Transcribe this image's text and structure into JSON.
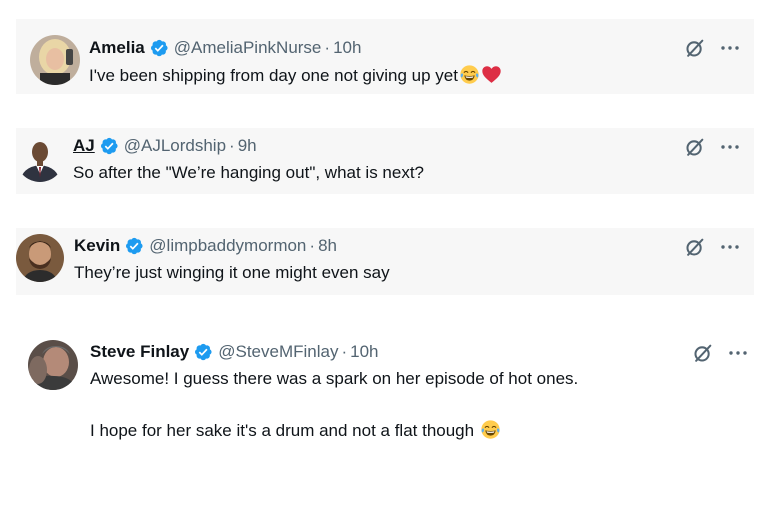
{
  "tweets": [
    {
      "name": "Amelia",
      "handle": "@AmeliaPinkNurse",
      "separator": "·",
      "time": "10h",
      "text": "I've been shipping from day one not giving up yet",
      "emojis": [
        "face-with-tears-of-joy",
        "red-heart"
      ]
    },
    {
      "name": "AJ",
      "handle": "@AJLordship",
      "separator": "·",
      "time": "9h",
      "text": "So after the \"We’re hanging out\", what is next?"
    },
    {
      "name": "Kevin",
      "handle": "@limpbaddymormon",
      "separator": "·",
      "time": "8h",
      "text": "They’re just winging it one might even say"
    },
    {
      "name": "Steve Finlay",
      "handle": "@SteveMFinlay",
      "separator": "·",
      "time": "10h",
      "text_line1": "Awesome! I guess there was a spark on her episode of hot ones.",
      "text_line2": "I hope for her sake it's a drum and not a flat though",
      "emojis": [
        "face-with-tears-of-joy"
      ]
    }
  ],
  "icons": {
    "verified": "verified-badge-icon",
    "grok": "grok-slash-icon",
    "more": "more-options-icon"
  },
  "colors": {
    "verified_blue": "#1d9bf0",
    "text": "#0f1419",
    "secondary": "#536471",
    "shaded_background": "#f7f7f7"
  }
}
